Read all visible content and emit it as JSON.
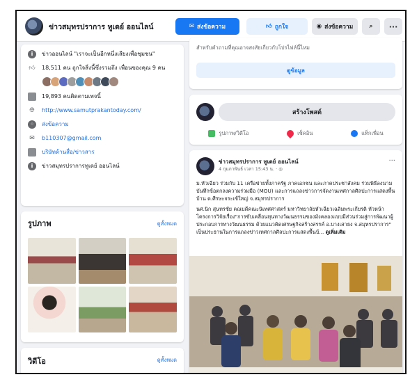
{
  "header": {
    "page_name": "ข่าวสมุทรปราการ ทูเดย์ ออนไลน์",
    "send_message_label": "ส่งข้อความ",
    "liked_label": "ถูกใจ",
    "contact_label": "ส่งข้อความ",
    "search_icon": "search-icon",
    "more_icon": "more-icon"
  },
  "about": {
    "description": "ข่าวออนไลน์ \"เราจะเป็นอีกหนึ่งเสียงเพื่อชุมชน\"",
    "likes": "18,511 คน ถูกใจสิ่งนี้ซึ่งรวมถึง เพื่อนของคุณ 9 คน",
    "followers": "19,893 คนติดตามเพจนี้",
    "website": "http://www.samutprakantoday.com/",
    "send_message": "ส่งข้อความ",
    "email": "b110307@gmail.com",
    "category": "บริษัทด้านสื่อ/ข่าวสาร",
    "name_line": "ข่าวสมุทรปราการทูเดย์ ออนไลน์"
  },
  "photos": {
    "title": "รูปภาพ",
    "see_all": "ดูทั้งหมด"
  },
  "videos": {
    "title": "วิดีโอ",
    "see_all": "ดูทั้งหมด"
  },
  "info_card": {
    "text_line1": "สำหรับคำถามที่คุณอาจสงสัยเกี่ยวกับโปรไฟล์นี้ไหม",
    "button_label": "ดูข้อมูล"
  },
  "create_post": {
    "label": "สร้างโพสต์",
    "photo_video": "รูปภาพ/วิดีโอ",
    "check_in": "เช็คอิน",
    "tag_friends": "แท็กเพื่อน"
  },
  "post": {
    "author": "ข่าวสมุทรปราการ ทูเดย์ ออนไลน์",
    "meta": "4 กุมภาพันธ์ เวลา 15:43 น. · ◎",
    "more_icon": "more-icon",
    "para1": "ม.หัวเฉียว ร่วมกับ 11 เครือข่ายทั้งภาครัฐ ภาคเอกชน และภาคประชาสังคม ร่วมพิธีลงนามบันทึกข้อตกลงความร่วมมือ (MOU) และการแถลงข่าวการจัดงานเทศกาลศิลปะการแสดงพื้นบ้าน ต.ศีรษะจระเข้ใหญ่ จ.สมุทรปราการ",
    "para2": "นศ.นิก สุนทรชัย คณบดีคณะนิเทศศาสตร์ มหาวิทยาลัยหัวเฉียวเฉลิมพระเกียรติ หัวหน้าโครงการวิจัยเรื่อง\"การขับเคลื่อนทุนทางวัฒนธรรมของมังคลองแบบมีส่วนร่วมสู่การพัฒนาผู้ประกอบการทางวัฒนธรรม ด้วยแนวคิดเศรษฐกิจสร้างสรรค์ อ.บางเสาธง จ.สมุทรปราการ\" เป็นประธานในการแถลงข่าวเทศกาลศิลปะการแสดงพื้นบ้...",
    "see_more": "ดูเพิ่มเติม"
  },
  "colors": {
    "accent": "#1877f2",
    "link": "#216fdb",
    "background": "#f0f2f5"
  }
}
